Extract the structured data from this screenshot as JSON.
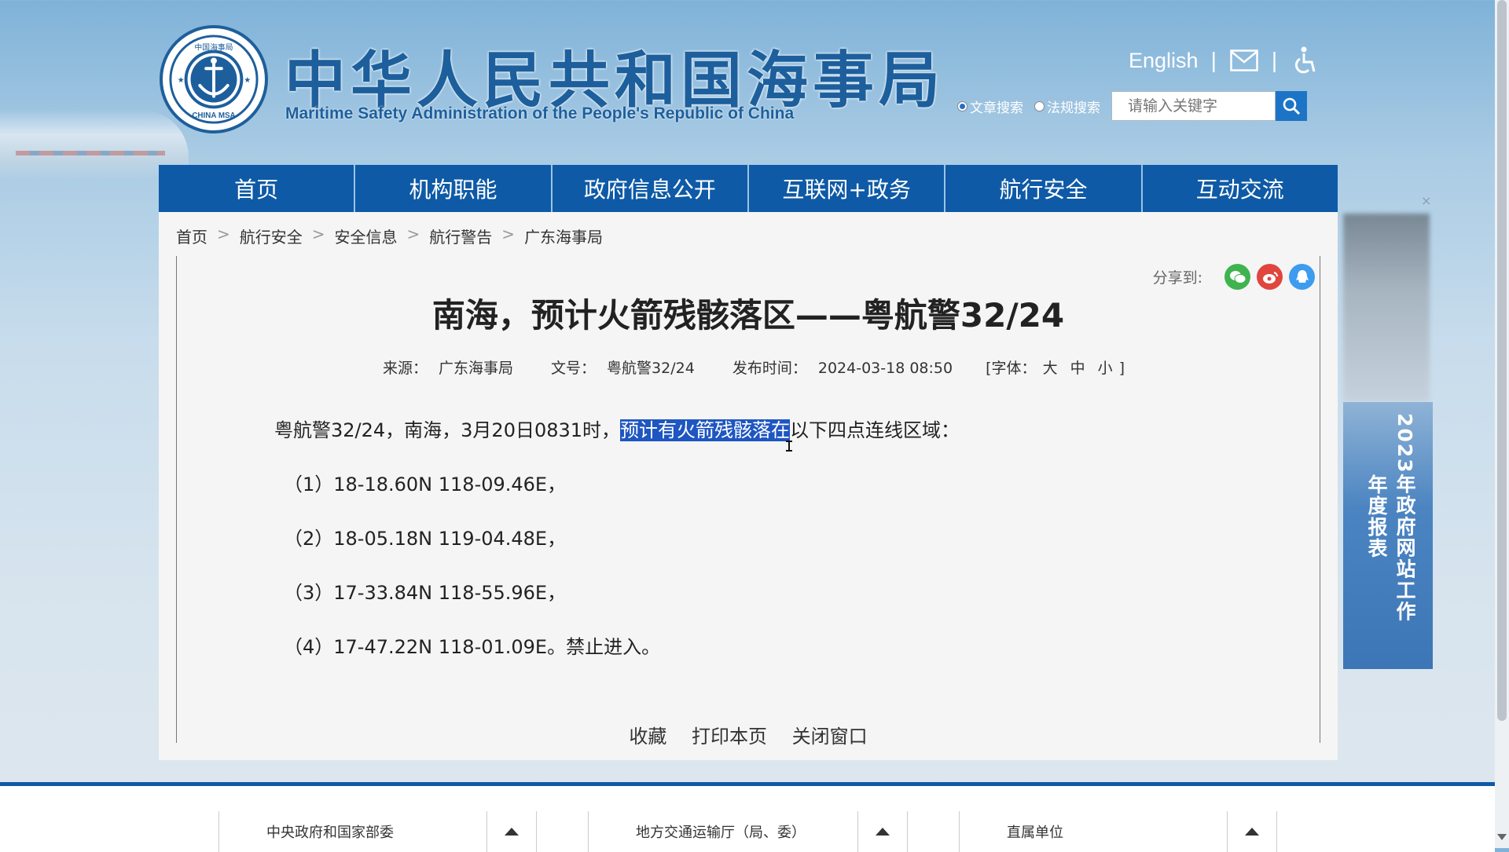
{
  "header": {
    "site_title": "中华人民共和国海事局",
    "site_subtitle": "Maritime Safety Administration of the People's Republic of China",
    "logo_text_top": "中国海事局",
    "logo_text_bottom": "CHINA MSA",
    "english_link": "English",
    "separator": "|",
    "search_radio_article": "文章搜索",
    "search_radio_law": "法规搜索",
    "search_placeholder": "请输入关键字"
  },
  "nav": {
    "items": [
      "首页",
      "机构职能",
      "政府信息公开",
      "互联网+政务",
      "航行安全",
      "互动交流"
    ]
  },
  "breadcrumb": [
    "首页",
    "航行安全",
    "安全信息",
    "航行警告",
    "广东海事局"
  ],
  "breadcrumb_separator": ">",
  "share_label": "分享到:",
  "article": {
    "title": "南海，预计火箭残骸落区——粤航警32/24",
    "source_label": "来源：",
    "source": "广东海事局",
    "doc_no_label": "文号：",
    "doc_no": "粤航警32/24",
    "publish_label": "发布时间：",
    "publish_time": "2024-03-18 08:50",
    "font_size_label": "[字体：",
    "font_large": "大",
    "font_medium": "中",
    "font_small": "小",
    "font_close": "]",
    "lead_before": "粤航警32/24，南海，3月20日0831时，",
    "lead_highlight": "预计有火箭残骸落在",
    "lead_after": "以下四点连线区域：",
    "coords": [
      "（1）18-18.60N 118-09.46E，",
      "（2）18-05.18N 119-04.48E，",
      "（3）17-33.84N 118-55.96E，",
      "（4）17-47.22N 118-01.09E。禁止进入。"
    ],
    "actions": [
      "收藏",
      "打印本页",
      "关闭窗口"
    ]
  },
  "side_banner": {
    "close": "×",
    "line1": "2023年政府网站工作",
    "line2": "年度报表"
  },
  "footer": {
    "selects": [
      "中央政府和国家部委",
      "地方交通运输厅（局、委）",
      "直属单位"
    ]
  },
  "colors": {
    "nav_bg": "#0e5aa6",
    "title_blue": "#1d5f9c",
    "highlight": "#1e56c2",
    "wechat": "#3fb34f",
    "weibo": "#e0453e",
    "qq": "#3d9bf0"
  }
}
